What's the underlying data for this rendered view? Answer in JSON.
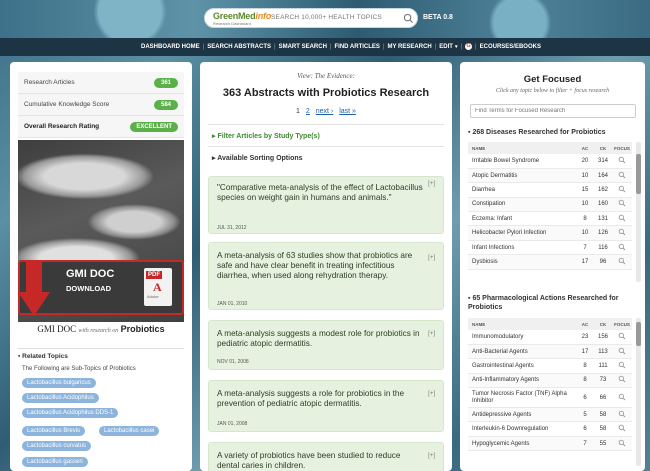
{
  "header": {
    "logo_main": "GreenMed",
    "logo_accent": "info",
    "logo_sub": "Research Dashboard",
    "search_placeholder": "SEARCH 10,000+ HEALTH TOPICS",
    "beta_label": "BETA 0.8"
  },
  "nav": {
    "items": [
      "DASHBOARD HOME",
      "SEARCH ABSTRACTS",
      "SMART SEARCH",
      "FIND ARTICLES",
      "MY RESEARCH",
      "EDIT",
      "ECOURSES/EBOOKS"
    ]
  },
  "stats": [
    {
      "label": "Research Articles",
      "value": "361"
    },
    {
      "label": "Cumulative Knowledge Score",
      "value": "584"
    },
    {
      "label": "Overall Research Rating",
      "value": "EXCELLENT"
    }
  ],
  "gmi": {
    "title": "GMI DOC",
    "sub": "DOWNLOAD",
    "pdf_label": "PDF",
    "adobe": "Adobe",
    "caption_a": "GMI DOC",
    "caption_b": "with research on",
    "caption_c": "Probiotics"
  },
  "related": {
    "heading": "Related Topics",
    "sub": "The Following are Sub-Topics of Probiotics",
    "tags": [
      "Lactobacillus bulgaricus",
      "Lactobacillus Acidophilus",
      "Lactobacillus Acidophilus DDS-1",
      "Lactobacillus Brevis",
      "Lactobacillus curvatus",
      "Lactobacillus casei",
      "Lactobacillus gasseri"
    ]
  },
  "main": {
    "view_label": "View: The Evidence:",
    "title": "363 Abstracts with Probiotics Research",
    "pager": {
      "current": "1",
      "page2": "2",
      "next": "next ›",
      "last": "last »"
    },
    "filter_label": "Filter Articles by Study Type(s)",
    "sort_label": "Available Sorting Options",
    "cards": [
      {
        "text": "\"Comparative meta-analysis of the effect of Lactobacillus species on weight gain in humans and animals.\"",
        "date": "JUL 31, 2012"
      },
      {
        "text": "A meta-analysis of 63 studies show that probiotics are safe and have clear benefit in treating infectitious diarrhea, when used along rehydration therapy.",
        "date": "JAN 01, 2010"
      },
      {
        "text": "A meta-analysis suggests a modest role for probiotics in pediatric atopic dermatitis.",
        "date": "NOV 01, 2008"
      },
      {
        "text": "A meta-analysis suggests a role for probiotics in the prevention of pediatric atopic dermatitis.",
        "date": "JAN 01, 2008"
      },
      {
        "text": "A variety of probiotics have been studied to reduce dental caries in children.",
        "date": ""
      }
    ],
    "plus": "[+]"
  },
  "right": {
    "title": "Get Focused",
    "sub": "Click any topic below to filter + focus research",
    "search_placeholder": "Find Terms for Focused Research",
    "diseases_head": "268 Diseases Researched for Probiotics",
    "pharma_head": "65 Pharmacological Actions Researched for Probiotics",
    "cols": {
      "name": "NAME",
      "ac": "AC",
      "ck": "CK",
      "focus": "FOCUS"
    },
    "diseases": [
      {
        "name": "Irritable Bowel Syndrome",
        "ac": "20",
        "ck": "314"
      },
      {
        "name": "Atopic Dermatitis",
        "ac": "10",
        "ck": "164"
      },
      {
        "name": "Diarrhea",
        "ac": "15",
        "ck": "162"
      },
      {
        "name": "Constipation",
        "ac": "10",
        "ck": "160"
      },
      {
        "name": "Eczema: Infant",
        "ac": "8",
        "ck": "131"
      },
      {
        "name": "Helicobacter Pylori Infection",
        "ac": "10",
        "ck": "126"
      },
      {
        "name": "Infant Infections",
        "ac": "7",
        "ck": "116"
      },
      {
        "name": "Dysbiosis",
        "ac": "17",
        "ck": "96"
      }
    ],
    "pharma": [
      {
        "name": "Immunomodulatory",
        "ac": "23",
        "ck": "156"
      },
      {
        "name": "Anti-Bacterial Agents",
        "ac": "17",
        "ck": "113"
      },
      {
        "name": "Gastrointestinal Agents",
        "ac": "8",
        "ck": "111"
      },
      {
        "name": "Anti-Inflammatory Agents",
        "ac": "8",
        "ck": "73"
      },
      {
        "name": "Tumor Necrosis Factor (TNF) Alpha Inhibitor",
        "ac": "6",
        "ck": "66"
      },
      {
        "name": "Antidepressive Agents",
        "ac": "5",
        "ck": "58"
      },
      {
        "name": "Interleukin-6 Downregulation",
        "ac": "6",
        "ck": "58"
      },
      {
        "name": "Hypoglycemic Agents",
        "ac": "7",
        "ck": "55"
      }
    ]
  },
  "colors": {
    "nav_bg": "#1d3444",
    "accent_green": "#5cb04a",
    "card_bg": "#e6f2df",
    "tag_blue": "#8cb4dc",
    "pdf_red": "#c62828"
  },
  "icons": [
    "search-icon",
    "google-icon",
    "arrow-down-icon",
    "pdf-icon",
    "magnifier-icon",
    "bullet-icon"
  ]
}
